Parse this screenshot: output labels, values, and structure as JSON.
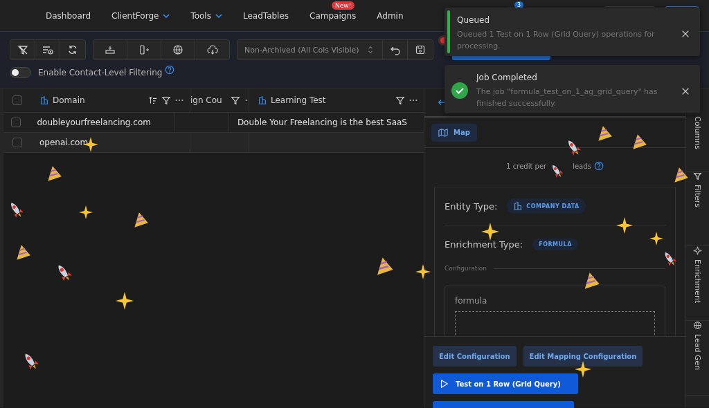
{
  "nav": {
    "items": [
      {
        "label": "Dashboard",
        "dropdown": false
      },
      {
        "label": "ClientForge",
        "dropdown": true
      },
      {
        "label": "Tools",
        "dropdown": true
      },
      {
        "label": "LeadTables",
        "dropdown": false
      },
      {
        "label": "Campaigns",
        "dropdown": false,
        "badge": "New!"
      },
      {
        "label": "Admin",
        "dropdown": false
      }
    ],
    "notification_count": "3"
  },
  "toolbar": {
    "view_select": {
      "value": "Non-Archived (All Cols Visible)"
    },
    "unsaved_changes": true,
    "contact_filter": {
      "label": "Enable Contact-Level Filtering",
      "on": false
    }
  },
  "grid": {
    "all_selected": false,
    "columns": [
      {
        "label": "Domain",
        "sortable": true
      },
      {
        "label": "ign Cou",
        "sortable": false
      },
      {
        "label": "Learning Test",
        "sortable": false
      }
    ],
    "rows": [
      {
        "checked": false,
        "domain": "doubleyourfreelancing.com",
        "learning_test": "Double Your Freelancing is the best SaaS"
      },
      {
        "checked": false,
        "domain": "openai.com"
      }
    ]
  },
  "panel": {
    "map_button": "Map",
    "credit_start": "1 credit per",
    "credit_end": "leads",
    "entity_type": {
      "label": "Entity Type:",
      "value": "COMPANY DATA"
    },
    "enrichment_type": {
      "label": "Enrichment Type:",
      "value": "FORMULA"
    },
    "configuration_label": "Configuration",
    "formula_label": "formula",
    "buttons": [
      {
        "label": "Edit Configuration",
        "kind": "secondary"
      },
      {
        "label": "Edit Mapping Configuration",
        "kind": "secondary"
      },
      {
        "label": "Test on 1 Row (Grid Query)",
        "kind": "primary"
      }
    ]
  },
  "sidebar_tabs": [
    {
      "label": "Columns"
    },
    {
      "label": "Filters"
    },
    {
      "label": "Enrichment"
    },
    {
      "label": "Lead Gen"
    }
  ],
  "toasts": [
    {
      "kind": "progress",
      "title": "Queued",
      "message": "Queued 1 Test on 1 Row (Grid Query) operations for processing."
    },
    {
      "kind": "success",
      "title": "Job Completed",
      "message": "The job \"formula_test_on_1_ag_grid_query\" has finished successfully."
    }
  ]
}
